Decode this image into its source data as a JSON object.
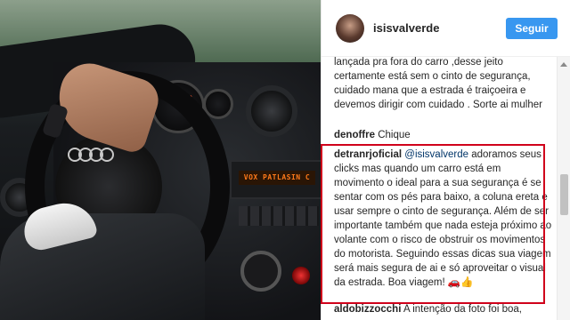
{
  "profile": {
    "username": "isisvalverde",
    "follow_label": "Seguir"
  },
  "photo": {
    "radio_text": "VOX PATLASIN C"
  },
  "comments": [
    {
      "user": "",
      "text": "lançada pra fora do carro ,desse jeito certamente está sem o cinto de segurança, cuidado mana que a estrada é traiçoeira e devemos dirigir com cuidado . Sorte ai mulher"
    },
    {
      "user": "denoffre",
      "text": "Chique"
    },
    {
      "user": "detranrjoficial",
      "mention": "@isisvalverde",
      "text": "adoramos seus clicks mas quando um carro está em movimento o ideal para a sua segurança é se sentar com os pés para baixo, a coluna ereta e usar sempre o cinto de segurança. Além de ser importante também que nada esteja próximo ao volante com o risco de obstruir os movimentos do motorista. Seguindo essas dicas sua viagem será mais segura de ai e só aproveitar o visual da estrada. Boa viagem! 🚗👍"
    },
    {
      "user": "aldobizzocchi",
      "text": "A intenção da foto foi boa,"
    }
  ],
  "colors": {
    "follow_button": "#3897f0",
    "highlight_border": "#d0021b",
    "mention": "#003569"
  }
}
